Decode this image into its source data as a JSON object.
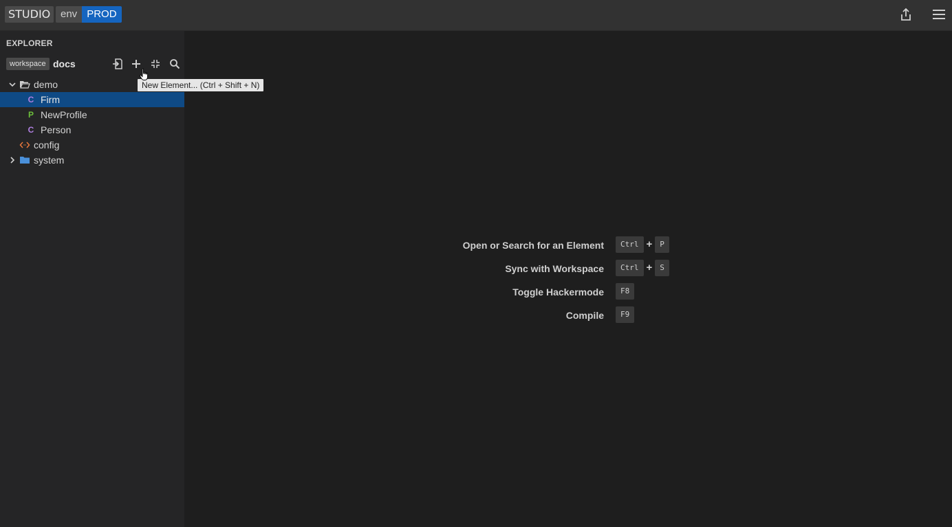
{
  "header": {
    "app_name": "STUDIO",
    "env_label": "env",
    "env_value": "PROD",
    "share_icon": "share-icon",
    "menu_icon": "hamburger-menu-icon"
  },
  "sidebar": {
    "title": "EXPLORER",
    "workspace_badge": "workspace",
    "workspace_name": "docs",
    "toolbar_icons": [
      "import-icon",
      "plus-icon",
      "collapse-icon",
      "search-icon"
    ],
    "tree": [
      {
        "label": "demo",
        "icon": "folder-open-icon",
        "expanded": true
      },
      {
        "label": "Firm",
        "type_letter": "C",
        "selected": true
      },
      {
        "label": "NewProfile",
        "type_letter": "P"
      },
      {
        "label": "Person",
        "type_letter": "C"
      },
      {
        "label": "config",
        "icon": "code-icon"
      },
      {
        "label": "system",
        "icon": "folder-icon",
        "expanded": false
      }
    ]
  },
  "tooltip": {
    "text": "New Element... (Ctrl + Shift + N)"
  },
  "shortcuts": [
    {
      "label": "Open or Search for an Element",
      "keys": [
        "Ctrl",
        "P"
      ]
    },
    {
      "label": "Sync with Workspace",
      "keys": [
        "Ctrl",
        "S"
      ]
    },
    {
      "label": "Toggle Hackermode",
      "keys": [
        "F8"
      ]
    },
    {
      "label": "Compile",
      "keys": [
        "F9"
      ]
    }
  ],
  "colors": {
    "accent": "#1565c0",
    "selection": "#0f4a85",
    "class_letter": "#b07fe0",
    "profile_letter": "#6cbf3b",
    "config_icon": "#e8773c",
    "folder_icon": "#4a90d9"
  }
}
